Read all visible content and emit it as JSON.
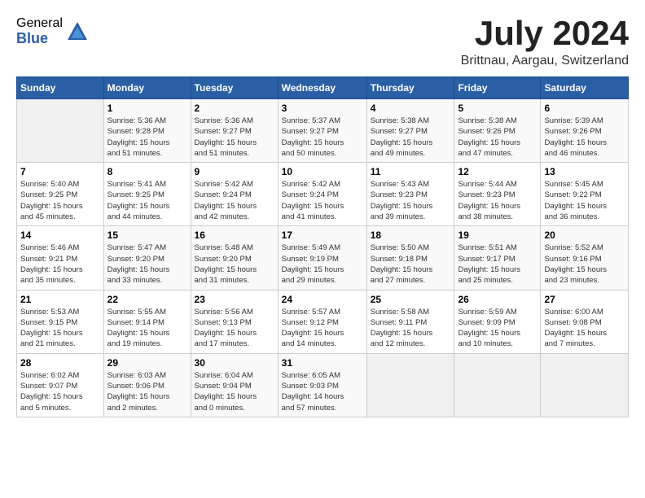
{
  "header": {
    "logo_general": "General",
    "logo_blue": "Blue",
    "month_year": "July 2024",
    "location": "Brittnau, Aargau, Switzerland"
  },
  "calendar": {
    "days_of_week": [
      "Sunday",
      "Monday",
      "Tuesday",
      "Wednesday",
      "Thursday",
      "Friday",
      "Saturday"
    ],
    "weeks": [
      [
        {
          "day": "",
          "info": ""
        },
        {
          "day": "1",
          "info": "Sunrise: 5:36 AM\nSunset: 9:28 PM\nDaylight: 15 hours\nand 51 minutes."
        },
        {
          "day": "2",
          "info": "Sunrise: 5:36 AM\nSunset: 9:27 PM\nDaylight: 15 hours\nand 51 minutes."
        },
        {
          "day": "3",
          "info": "Sunrise: 5:37 AM\nSunset: 9:27 PM\nDaylight: 15 hours\nand 50 minutes."
        },
        {
          "day": "4",
          "info": "Sunrise: 5:38 AM\nSunset: 9:27 PM\nDaylight: 15 hours\nand 49 minutes."
        },
        {
          "day": "5",
          "info": "Sunrise: 5:38 AM\nSunset: 9:26 PM\nDaylight: 15 hours\nand 47 minutes."
        },
        {
          "day": "6",
          "info": "Sunrise: 5:39 AM\nSunset: 9:26 PM\nDaylight: 15 hours\nand 46 minutes."
        }
      ],
      [
        {
          "day": "7",
          "info": "Sunrise: 5:40 AM\nSunset: 9:25 PM\nDaylight: 15 hours\nand 45 minutes."
        },
        {
          "day": "8",
          "info": "Sunrise: 5:41 AM\nSunset: 9:25 PM\nDaylight: 15 hours\nand 44 minutes."
        },
        {
          "day": "9",
          "info": "Sunrise: 5:42 AM\nSunset: 9:24 PM\nDaylight: 15 hours\nand 42 minutes."
        },
        {
          "day": "10",
          "info": "Sunrise: 5:42 AM\nSunset: 9:24 PM\nDaylight: 15 hours\nand 41 minutes."
        },
        {
          "day": "11",
          "info": "Sunrise: 5:43 AM\nSunset: 9:23 PM\nDaylight: 15 hours\nand 39 minutes."
        },
        {
          "day": "12",
          "info": "Sunrise: 5:44 AM\nSunset: 9:23 PM\nDaylight: 15 hours\nand 38 minutes."
        },
        {
          "day": "13",
          "info": "Sunrise: 5:45 AM\nSunset: 9:22 PM\nDaylight: 15 hours\nand 36 minutes."
        }
      ],
      [
        {
          "day": "14",
          "info": "Sunrise: 5:46 AM\nSunset: 9:21 PM\nDaylight: 15 hours\nand 35 minutes."
        },
        {
          "day": "15",
          "info": "Sunrise: 5:47 AM\nSunset: 9:20 PM\nDaylight: 15 hours\nand 33 minutes."
        },
        {
          "day": "16",
          "info": "Sunrise: 5:48 AM\nSunset: 9:20 PM\nDaylight: 15 hours\nand 31 minutes."
        },
        {
          "day": "17",
          "info": "Sunrise: 5:49 AM\nSunset: 9:19 PM\nDaylight: 15 hours\nand 29 minutes."
        },
        {
          "day": "18",
          "info": "Sunrise: 5:50 AM\nSunset: 9:18 PM\nDaylight: 15 hours\nand 27 minutes."
        },
        {
          "day": "19",
          "info": "Sunrise: 5:51 AM\nSunset: 9:17 PM\nDaylight: 15 hours\nand 25 minutes."
        },
        {
          "day": "20",
          "info": "Sunrise: 5:52 AM\nSunset: 9:16 PM\nDaylight: 15 hours\nand 23 minutes."
        }
      ],
      [
        {
          "day": "21",
          "info": "Sunrise: 5:53 AM\nSunset: 9:15 PM\nDaylight: 15 hours\nand 21 minutes."
        },
        {
          "day": "22",
          "info": "Sunrise: 5:55 AM\nSunset: 9:14 PM\nDaylight: 15 hours\nand 19 minutes."
        },
        {
          "day": "23",
          "info": "Sunrise: 5:56 AM\nSunset: 9:13 PM\nDaylight: 15 hours\nand 17 minutes."
        },
        {
          "day": "24",
          "info": "Sunrise: 5:57 AM\nSunset: 9:12 PM\nDaylight: 15 hours\nand 14 minutes."
        },
        {
          "day": "25",
          "info": "Sunrise: 5:58 AM\nSunset: 9:11 PM\nDaylight: 15 hours\nand 12 minutes."
        },
        {
          "day": "26",
          "info": "Sunrise: 5:59 AM\nSunset: 9:09 PM\nDaylight: 15 hours\nand 10 minutes."
        },
        {
          "day": "27",
          "info": "Sunrise: 6:00 AM\nSunset: 9:08 PM\nDaylight: 15 hours\nand 7 minutes."
        }
      ],
      [
        {
          "day": "28",
          "info": "Sunrise: 6:02 AM\nSunset: 9:07 PM\nDaylight: 15 hours\nand 5 minutes."
        },
        {
          "day": "29",
          "info": "Sunrise: 6:03 AM\nSunset: 9:06 PM\nDaylight: 15 hours\nand 2 minutes."
        },
        {
          "day": "30",
          "info": "Sunrise: 6:04 AM\nSunset: 9:04 PM\nDaylight: 15 hours\nand 0 minutes."
        },
        {
          "day": "31",
          "info": "Sunrise: 6:05 AM\nSunset: 9:03 PM\nDaylight: 14 hours\nand 57 minutes."
        },
        {
          "day": "",
          "info": ""
        },
        {
          "day": "",
          "info": ""
        },
        {
          "day": "",
          "info": ""
        }
      ]
    ]
  }
}
